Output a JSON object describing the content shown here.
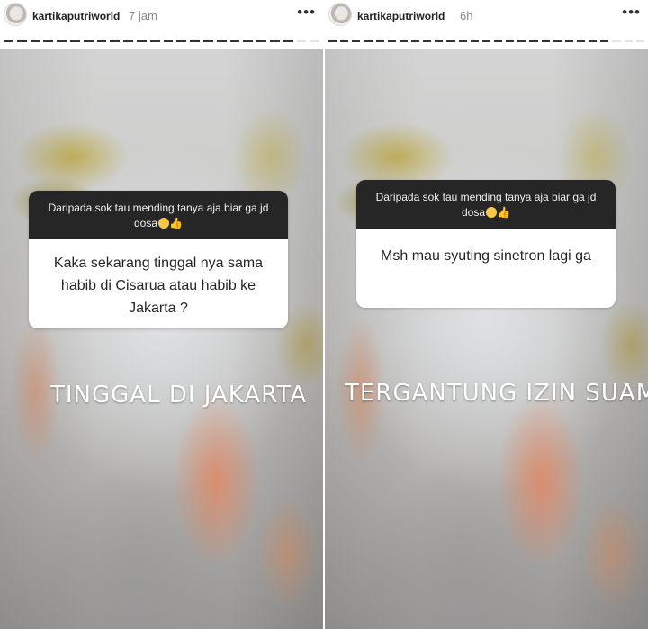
{
  "stories": [
    {
      "username": "kartikaputriworld",
      "time": "7 jam",
      "more": "•••",
      "question_prompt": "Daripada sok tau mending tanya aja biar ga jd dosa",
      "question_text": "Kaka sekarang tinggal nya sama habib di Cisarua atau habib ke Jakarta ?",
      "answer": "TINGGAL DI JAKARTA"
    },
    {
      "username": "kartikaputriworld",
      "time": "6h",
      "more": "•••",
      "question_prompt": "Daripada sok tau mending tanya aja biar ga jd dosa",
      "question_text": "Msh mau syuting sinetron lagi ga",
      "answer": "TERGANTUNG IZIN SUAMI"
    }
  ],
  "icons": {
    "emoji_smile": "smiling-face-icon",
    "emoji_thumb": "thumbs-up-icon",
    "emoji_relieved": "relieved-face-icon"
  }
}
